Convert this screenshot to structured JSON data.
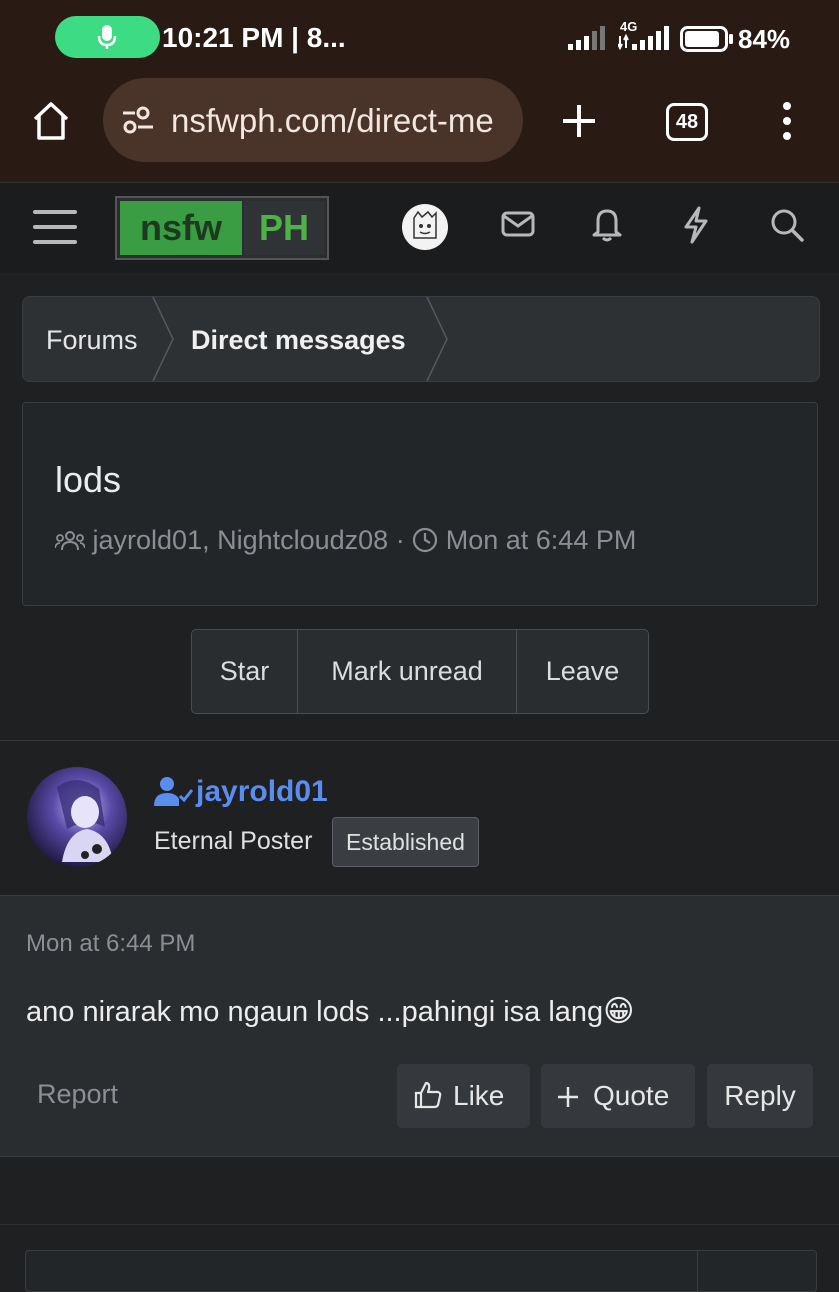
{
  "status_bar": {
    "time": "10:21 PM | 8...",
    "network": "4G",
    "battery": "84%"
  },
  "browser": {
    "url": "nsfwph.com/direct-me",
    "tab_count": "48"
  },
  "site": {
    "logo_left": "nsfw",
    "logo_right": "PH",
    "colors": {
      "logo_green": "#3a9c43",
      "username_blue": "#5b8def",
      "mic_pill": "#3ddc84"
    }
  },
  "breadcrumb": [
    "Forums",
    "Direct messages"
  ],
  "thread": {
    "title": "lods",
    "participants": "jayrold01, Nightcloudz08",
    "separator": "·",
    "time": "Mon at 6:44 PM"
  },
  "actions": [
    "Star",
    "Mark unread",
    "Leave"
  ],
  "message": {
    "username": "jayrold01",
    "user_title": "Eternal Poster",
    "badge": "Established",
    "date": "Mon at 6:44 PM",
    "text": "ano nirarak mo ngaun lods ...pahingi isa lang",
    "emoji": "😁",
    "report": "Report",
    "like": "Like",
    "quote": "Quote",
    "reply": "Reply"
  }
}
